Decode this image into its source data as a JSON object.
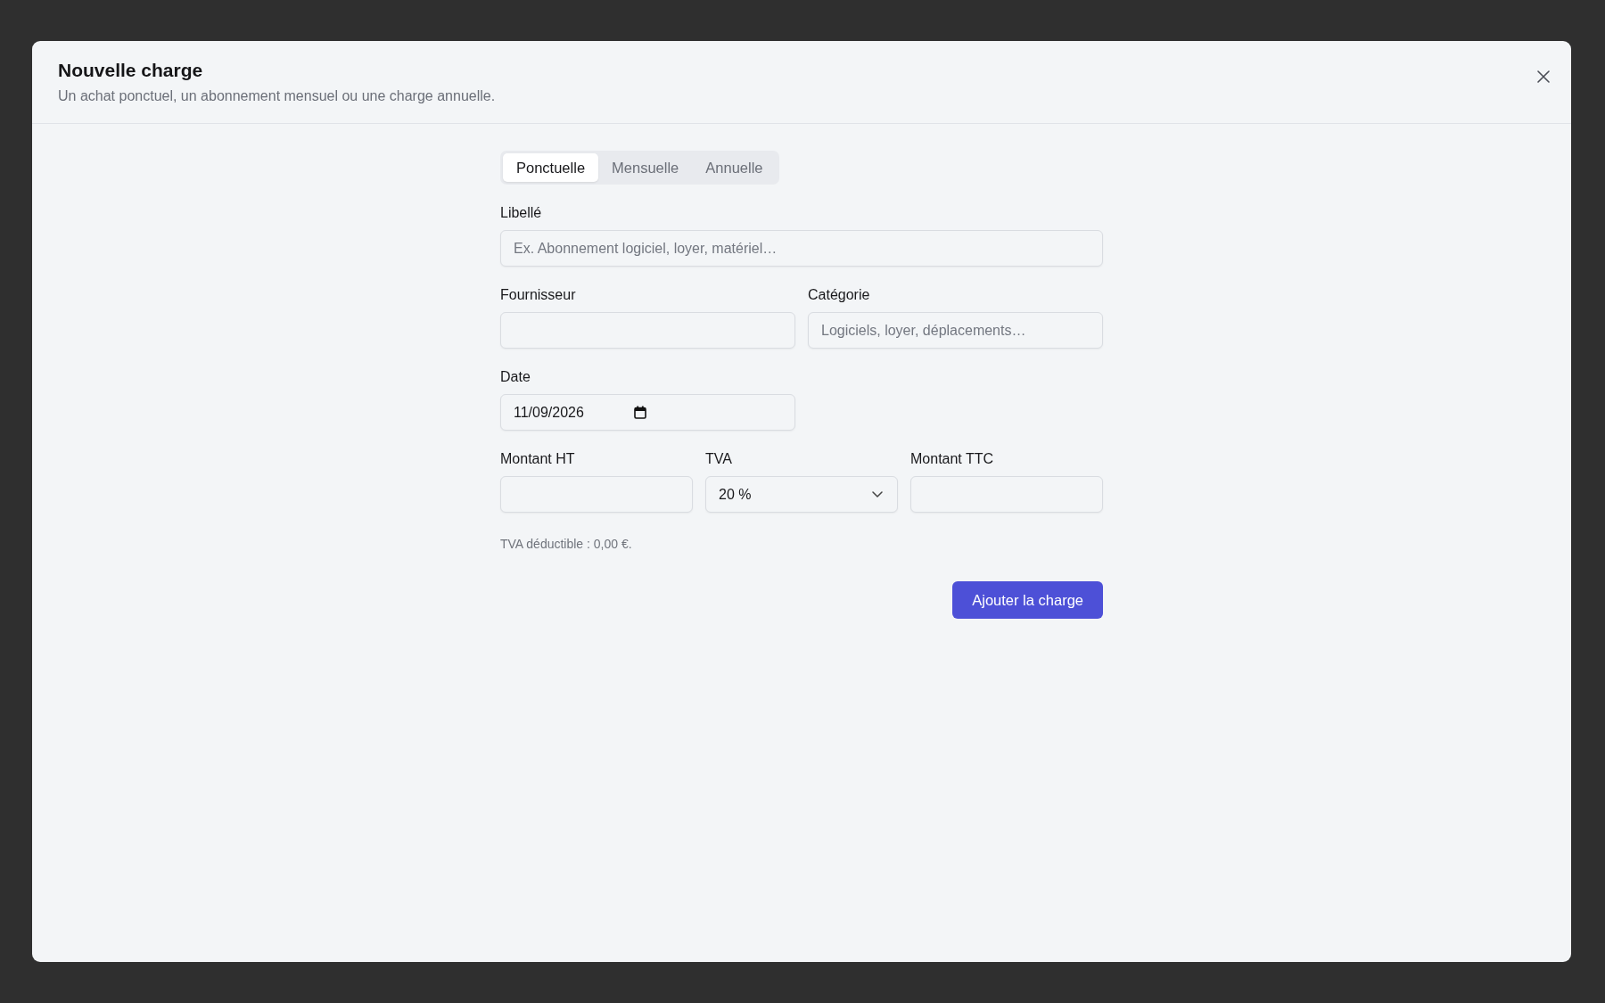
{
  "dialog": {
    "title": "Nouvelle charge",
    "subtitle": "Un achat ponctuel, un abonnement mensuel ou une charge annuelle.",
    "tabs": [
      {
        "label": "Ponctuelle",
        "selected": true
      },
      {
        "label": "Mensuelle",
        "selected": false
      },
      {
        "label": "Annuelle",
        "selected": false
      }
    ],
    "rows": [
      {
        "fields": [
          {
            "kind": "text",
            "label": "Libellé",
            "placeholder": "Ex. Abonnement logiciel, loyer, matériel…"
          }
        ]
      },
      {
        "fields": [
          {
            "kind": "text",
            "label": "Fournisseur"
          },
          {
            "kind": "text",
            "label": "Catégorie",
            "placeholder": "Logiciels, loyer, déplacements…"
          }
        ]
      },
      {
        "fields": [
          {
            "kind": "date",
            "label": "Date",
            "value": "11/09/2026"
          }
        ]
      },
      {
        "fields": [
          {
            "kind": "text",
            "label": "Montant HT"
          },
          {
            "kind": "select",
            "label": "TVA",
            "value": "20 %"
          },
          {
            "kind": "text",
            "label": "Montant TTC"
          }
        ]
      }
    ],
    "note": "TVA déductible : 0,00 €.",
    "submit_button": "Ajouter la charge"
  }
}
